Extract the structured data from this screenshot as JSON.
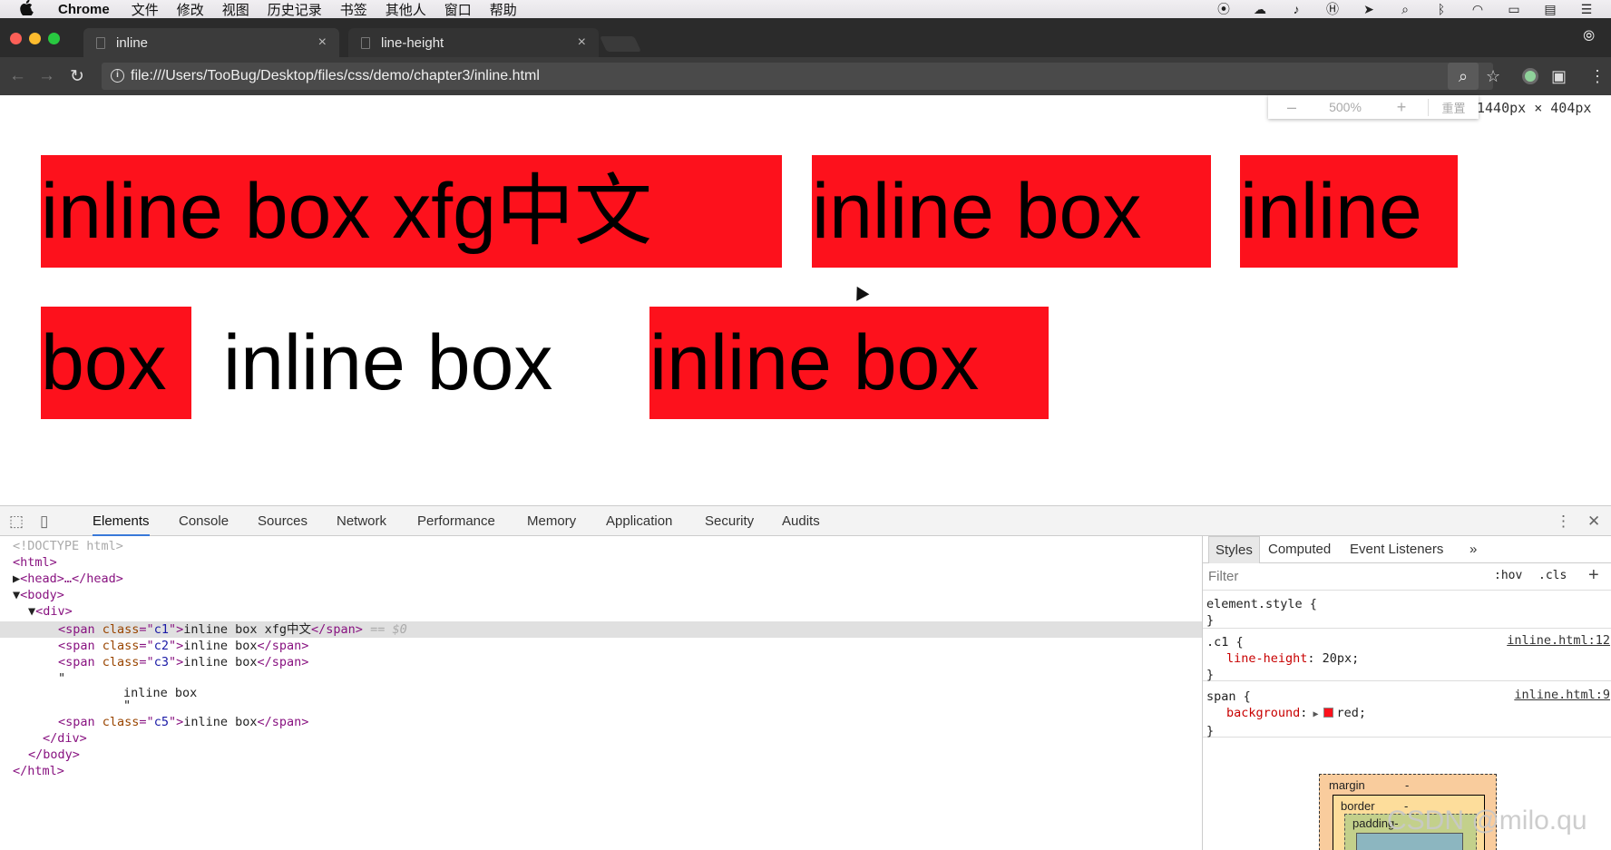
{
  "menubar": {
    "app": "Chrome",
    "items": [
      "文件",
      "修改",
      "视图",
      "历史记录",
      "书签",
      "其他人",
      "窗口",
      "帮助"
    ]
  },
  "tabs": [
    {
      "title": "inline",
      "close": "×"
    },
    {
      "title": "line-height",
      "close": "×"
    }
  ],
  "toolbar": {
    "url": "file:///Users/TooBug/Desktop/files/css/demo/chapter3/inline.html",
    "info_glyph": "i"
  },
  "zoom_popup": {
    "minus": "–",
    "value": "500%",
    "plus": "+",
    "reset": "重置"
  },
  "viewport_dims": "1440px × 404px",
  "demo": {
    "c1": "inline box xfg中文",
    "c2": "inline box",
    "c3_a": "inline",
    "c3_b": "box",
    "text": "inline box",
    "c5": "inline box",
    "highlight_color": "#fd111c"
  },
  "devtools": {
    "tabs": [
      "Elements",
      "Console",
      "Sources",
      "Network",
      "Performance",
      "Memory",
      "Application",
      "Security",
      "Audits"
    ],
    "active_tab": "Elements",
    "dom": {
      "doctype": "<!DOCTYPE html>",
      "html_open": "<html>",
      "head": "<head>…</head>",
      "body_open": "<body>",
      "div_open": "<div>",
      "span_c1_class": "c1",
      "span_c1_text": "inline box xfg中文",
      "selected_marker": "== $0",
      "span_c2_class": "c2",
      "span_c2_text": "inline box",
      "span_c3_class": "c3",
      "span_c3_text": "inline box",
      "quote_open": "\"",
      "text_node": "inline box",
      "quote_close": "\"",
      "span_c5_class": "c5",
      "span_c5_text": "inline box",
      "div_close": "</div>",
      "body_close": "</body>",
      "html_close": "</html>"
    },
    "styles": {
      "tabs": [
        "Styles",
        "Computed",
        "Event Listeners",
        "»"
      ],
      "filter_placeholder": "Filter",
      "hov": ":hov",
      "cls": ".cls",
      "add": "+",
      "element_style": "element.style {",
      "rule1_selector": ".c1 {",
      "rule1_source": "inline.html:12",
      "rule1_prop": "line-height",
      "rule1_value": "20px;",
      "rule2_selector": "span {",
      "rule2_source": "inline.html:9",
      "rule2_prop": "background",
      "rule2_value": "red;",
      "close_brace": "}",
      "box_margin": "margin",
      "box_border": "border",
      "box_padding": "padding-",
      "dash": "-"
    }
  },
  "watermark": "CSDN @milo.qu"
}
